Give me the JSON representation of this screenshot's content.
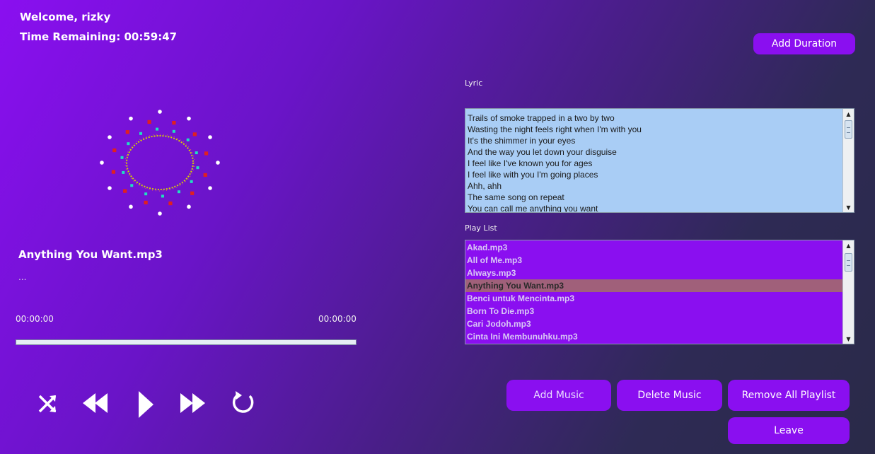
{
  "header": {
    "welcome": "Welcome, rizky",
    "time_remaining": "Time Remaining: 00:59:47",
    "add_duration_label": "Add Duration"
  },
  "now_playing": {
    "title": "Anything You Want.mp3",
    "artist": "...",
    "current_time": "00:00:00",
    "total_time": "00:00:00",
    "progress": 0
  },
  "controls": [
    "shuffle-icon",
    "rewind-icon",
    "play-icon",
    "fast-forward-icon",
    "repeat-icon"
  ],
  "lyric": {
    "label": "Lyric",
    "lines": [
      "Trails of smoke trapped in a two by two",
      "Wasting the night feels right when I'm with you",
      "It's the shimmer in your eyes",
      "And the way you let down your disguise",
      "I feel like I've known you for ages",
      "I feel like with you I'm going places",
      "Ahh, ahh",
      "The same song on repeat",
      "You can call me anything you want"
    ]
  },
  "playlist": {
    "label": "Play List",
    "selected_index": 3,
    "items": [
      "Akad.mp3",
      "All of Me.mp3",
      "Always.mp3",
      "Anything You Want.mp3",
      "Benci untuk Mencinta.mp3",
      "Born To Die.mp3",
      "Cari Jodoh.mp3",
      "Cinta Ini Membunuhku.mp3"
    ]
  },
  "actions": {
    "add_music": "Add Music",
    "delete_music": "Delete Music",
    "remove_all": "Remove All Playlist",
    "leave": "Leave"
  },
  "colors": {
    "accent": "#8a0ff0",
    "lyric_bg": "#a9cdf5",
    "selected_row": "#a0607a"
  }
}
